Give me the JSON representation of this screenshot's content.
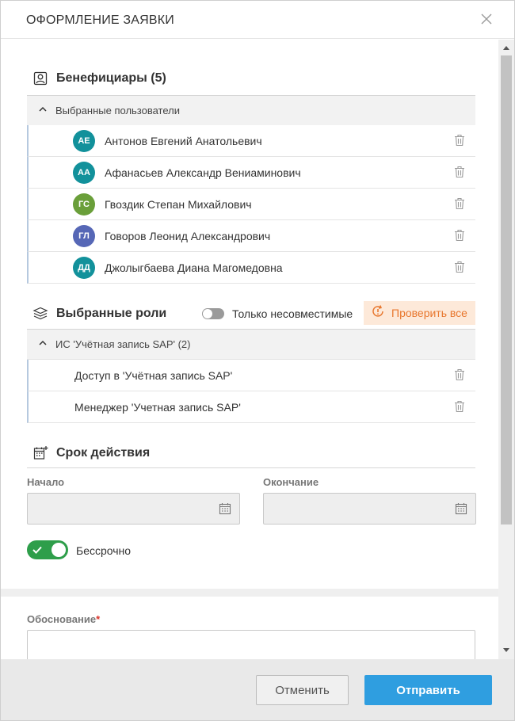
{
  "dialog": {
    "title": "ОФОРМЛЕНИЕ ЗАЯВКИ",
    "close_icon": "close-icon"
  },
  "beneficiaries": {
    "heading": "Бенефициары (5)",
    "icon": "user-card-icon",
    "group_label": "Выбранные пользователи",
    "users": [
      {
        "initials": "АЕ",
        "name": "Антонов Евгений Анатольевич",
        "color": "#12919b"
      },
      {
        "initials": "АА",
        "name": "Афанасьев Александр Вениаминович",
        "color": "#12919b"
      },
      {
        "initials": "ГС",
        "name": "Гвоздик Степан Михайлович",
        "color": "#6a9f3a"
      },
      {
        "initials": "ГЛ",
        "name": "Говоров Леонид Александрович",
        "color": "#5667b6"
      },
      {
        "initials": "ДД",
        "name": "Джолыгбаева Диана Магомедовна",
        "color": "#12919b"
      }
    ]
  },
  "roles": {
    "heading": "Выбранные роли",
    "icon": "roles-stack-icon",
    "toggle_label": "Только несовместимые",
    "check_all_label": "Проверить все",
    "check_all_color": "#e8772e",
    "group_label": "ИС 'Учётная запись SAP' (2)",
    "items": [
      {
        "name": "Доступ в 'Учётная запись SAP'"
      },
      {
        "name": "Менеджер 'Учетная запись SAP'"
      }
    ]
  },
  "validity": {
    "heading": "Срок действия",
    "icon": "calendar-add-icon",
    "start_label": "Начало",
    "end_label": "Окончание",
    "start_value": "",
    "end_value": "",
    "unlimited_label": "Бессрочно",
    "unlimited_on": true
  },
  "reason": {
    "label": "Обоснование",
    "required_mark": "*",
    "value": ""
  },
  "footer": {
    "cancel_label": "Отменить",
    "submit_label": "Отправить",
    "submit_color": "#2f9ee0"
  }
}
